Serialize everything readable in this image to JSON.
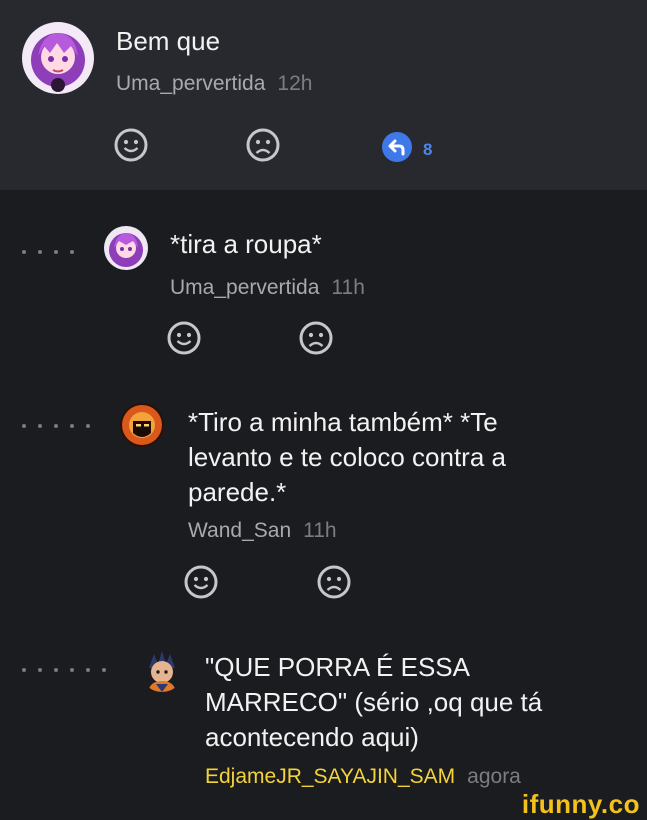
{
  "colors": {
    "background": "#1b1c20",
    "top_panel": "#28292e",
    "username": "#a9a9ad",
    "gold_username": "#f3d23a",
    "reply_accent": "#4b86f0",
    "watermark": "#f4c21a"
  },
  "comments": [
    {
      "text": "Bem que",
      "user": "Uma_pervertida",
      "time": "12h",
      "reply_count": "8",
      "avatar": "anime-girl-avatar"
    },
    {
      "text": "*tira a roupa*",
      "user": "Uma_pervertida",
      "time": "11h",
      "avatar": "anime-girl-avatar"
    },
    {
      "text_lines": [
        "*Tiro a minha também* *Te",
        "levanto e te coloco contra a",
        "parede.*"
      ],
      "user": "Wand_San",
      "time": "11h",
      "avatar": "masked-character-avatar"
    },
    {
      "text_lines": [
        "\"QUE PORRA É ESSA",
        "MARRECO\" (sério ,oq que tá",
        "acontecendo aqui)"
      ],
      "user": "EdjameJR_SAYAJIN_SAM",
      "time": "agora",
      "avatar": "saiyan-character-avatar"
    }
  ],
  "watermark": "ifunny.co",
  "icons": {
    "like": "smiley-face-icon",
    "dislike": "sad-face-icon",
    "reply": "reply-arrow-icon",
    "thread": "thread-dots-icon"
  }
}
